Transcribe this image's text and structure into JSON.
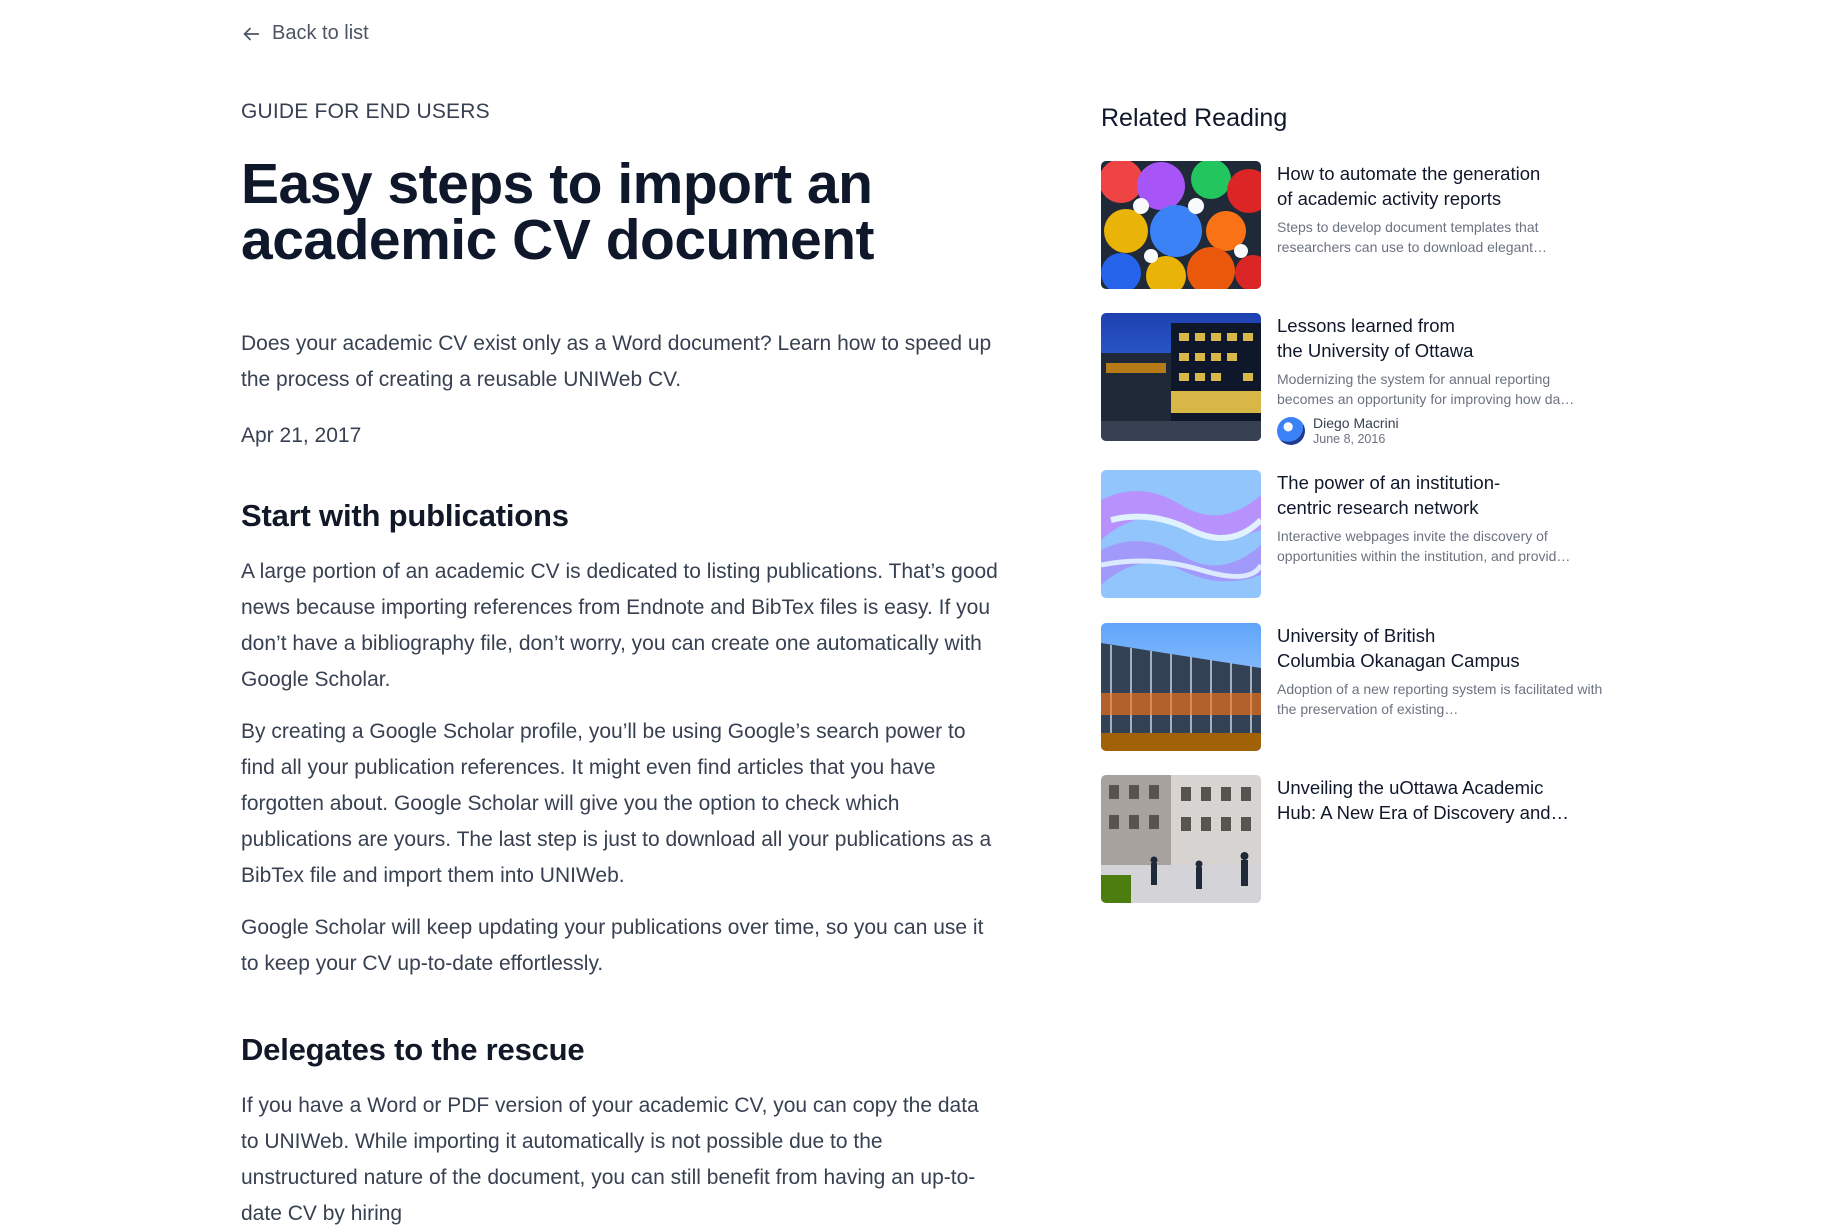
{
  "nav": {
    "back_label": "Back to list"
  },
  "article": {
    "eyebrow": "GUIDE FOR END USERS",
    "title": "Easy steps to import an academic CV document",
    "lede": "Does your academic CV exist only as a Word document? Learn how to speed up the process of creating a reusable UNIWeb CV.",
    "date": "Apr 21, 2017",
    "sections": [
      {
        "heading": "Start with publications",
        "paragraphs": [
          "A large portion of an academic CV is dedicated to listing publications. That’s good news because importing references from Endnote and BibTex files is easy. If you don’t have a bibliography file, don’t worry, you can create one automatically with Google Scholar.",
          "By creating a Google Scholar profile, you’ll be using Google’s search power to find all your publication references. It might even find articles that you have forgotten about. Google Scholar will give you the option to check which publications are yours. The last step is just to download all your publications as a BibTex file and import them into UNIWeb.",
          "Google Scholar will keep updating your publications over time, so you can use it to keep your CV up-to-date effortlessly."
        ]
      },
      {
        "heading": "Delegates to the rescue",
        "paragraphs": [
          "If you have a Word or PDF version of your academic CV, you can copy the data to UNIWeb. While importing it automatically is not possible due to the unstructured nature of the document, you can still benefit from having an up-to-date CV by hiring"
        ]
      }
    ]
  },
  "sidebar": {
    "heading": "Related Reading",
    "cards": [
      {
        "title_lines": [
          "How to automate the generation",
          "of academic activity reports"
        ],
        "description": "Steps to develop document templates that researchers can use to download elegant…",
        "image": "colorful-gears-image"
      },
      {
        "title_lines": [
          "Lessons learned from",
          "the University of Ottawa"
        ],
        "description": "Modernizing the system for annual reporting becomes an opportunity for improving how da…",
        "image": "ottawa-building-image",
        "author": {
          "name": "Diego Macrini",
          "date": "June 8, 2016"
        }
      },
      {
        "title_lines": [
          "The power of an institution-",
          "centric research network"
        ],
        "description": "Interactive webpages invite the discovery of opportunities within the institution, and provid…",
        "image": "research-network-image"
      },
      {
        "title_lines": [
          "University of British",
          "Columbia Okanagan Campus"
        ],
        "description": "Adoption of a new reporting system is facilitated with the preservation of existing…",
        "image": "ubc-campus-image"
      },
      {
        "title_lines": [
          "Unveiling the uOttawa Academic",
          "Hub: A New Era of Discovery and…"
        ],
        "description": "",
        "image": "uottawa-street-image"
      }
    ]
  },
  "colors": {
    "heading": "#0f172a",
    "body": "#374151",
    "muted": "#6b7280"
  }
}
